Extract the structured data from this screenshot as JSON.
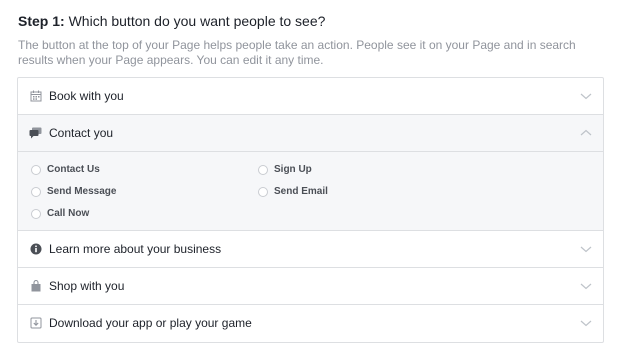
{
  "step": {
    "prefix": "Step 1:",
    "question": " Which button do you want people to see?",
    "description": "The button at the top of your Page helps people take an action. People see it on your Page and in search results when your Page appears. You can edit it any time."
  },
  "sections": [
    {
      "label": "Book with you",
      "icon": "calendar-icon",
      "expanded": false
    },
    {
      "label": "Contact you",
      "icon": "chat-bubble-icon",
      "expanded": true
    },
    {
      "label": "Learn more about your business",
      "icon": "info-icon",
      "expanded": false
    },
    {
      "label": "Shop with you",
      "icon": "shopping-bag-icon",
      "expanded": false
    },
    {
      "label": "Download your app or play your game",
      "icon": "download-icon",
      "expanded": false
    }
  ],
  "contact_options": {
    "contact_us": "Contact Us",
    "send_message": "Send Message",
    "call_now": "Call Now",
    "sign_up": "Sign Up",
    "send_email": "Send Email"
  },
  "colors": {
    "border": "#dddfe2",
    "expanded_bg": "#f6f7f9",
    "muted_text": "#90949c",
    "icon_gray": "#90949c"
  }
}
